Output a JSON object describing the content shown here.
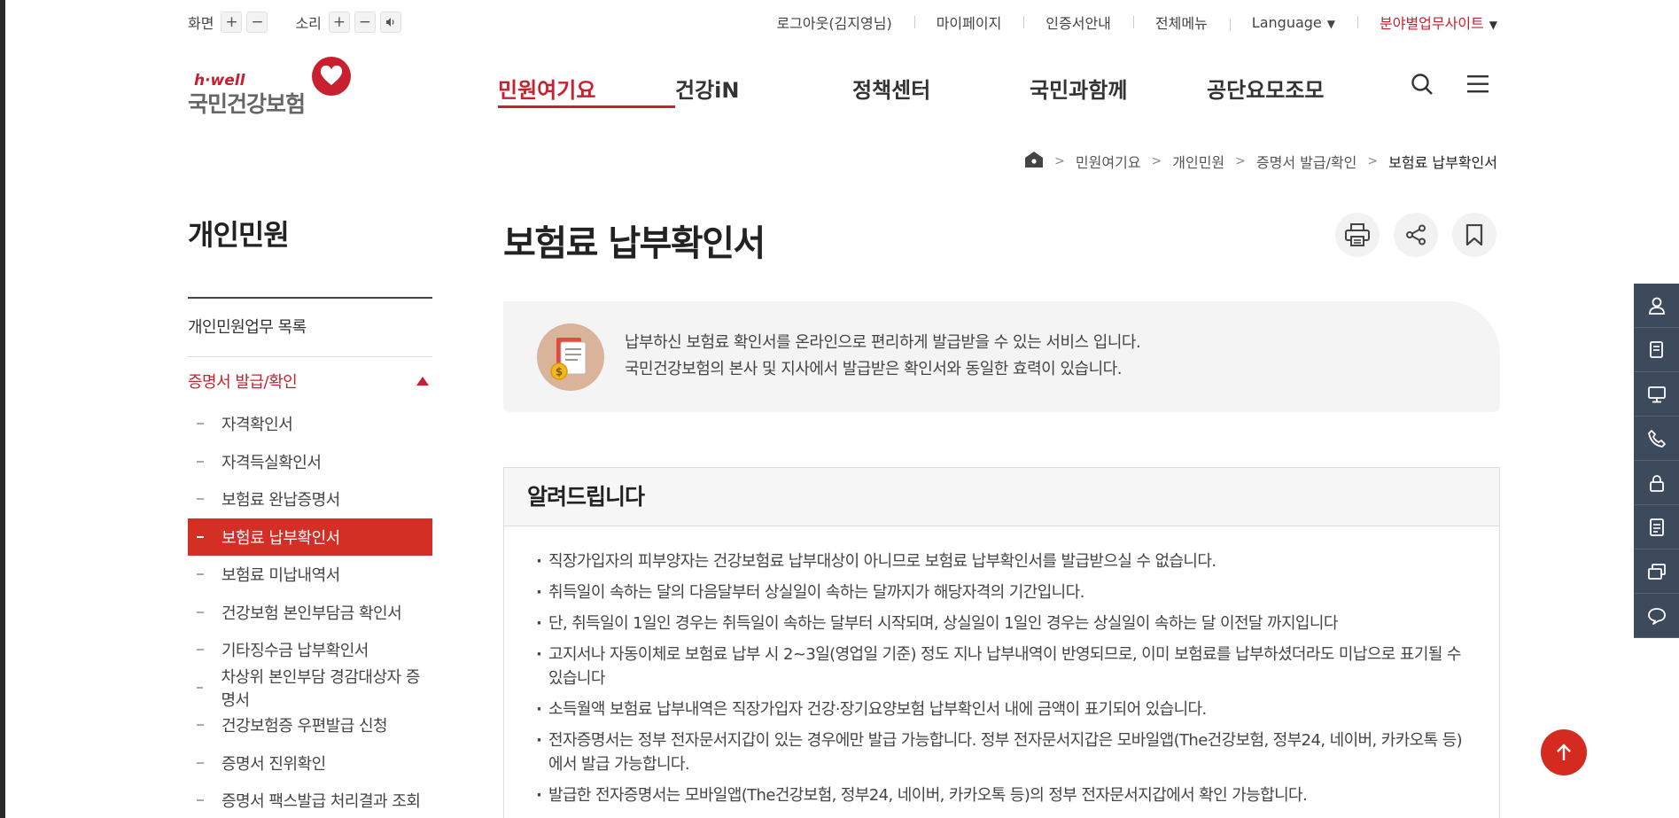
{
  "util": {
    "screen_label": "화면",
    "sound_label": "소리",
    "plus": "+",
    "minus": "−"
  },
  "top_links": [
    "로그아웃(김지영님)",
    "마이페이지",
    "인증서안내",
    "전체메뉴",
    "Language",
    "분야별업무사이트"
  ],
  "logo": {
    "brand_en": "h·well",
    "brand_ko": "국민건강보험"
  },
  "gnb": [
    "민원여기요",
    "건강iN",
    "정책센터",
    "국민과함께",
    "공단요모조모"
  ],
  "breadcrumb": [
    "민원여기요",
    "개인민원",
    "증명서 발급/확인",
    "보험료 납부확인서"
  ],
  "lnb": {
    "title": "개인민원",
    "top_item": "개인민원업무 목록",
    "open_section": "증명서 발급/확인",
    "items": [
      "자격확인서",
      "자격득실확인서",
      "보험료 완납증명서",
      "보험료 납부확인서",
      "보험료 미납내역서",
      "건강보험 본인부담금 확인서",
      "기타징수금 납부확인서",
      "차상위 본인부담 경감대상자 증명서",
      "건강보험증 우편발급 신청",
      "증명서 진위확인",
      "증명서 팩스발급 처리결과 조회"
    ],
    "active_index": 3
  },
  "page_title": "보험료 납부확인서",
  "intro": {
    "line1": "납부하신 보험료 확인서를 온라인으로 편리하게 발급받을 수 있는 서비스 입니다.",
    "line2": "국민건강보험의 본사 및 지사에서 발급받은 확인서와 동일한 효력이 있습니다."
  },
  "notice": {
    "title": "알려드립니다",
    "items": [
      "직장가입자의 피부양자는 건강보험료 납부대상이 아니므로 보험료 납부확인서를 발급받으실 수 없습니다.",
      "취득일이 속하는 달의 다음달부터 상실일이 속하는 달까지가 해당자격의 기간입니다.",
      "단, 취득일이 1일인 경우는 취득일이 속하는 달부터 시작되며, 상실일이 1일인 경우는 상실일이 속하는 달 이전달 까지입니다",
      "고지서나 자동이체로 보험료 납부 시 2~3일(영업일 기준) 정도 지나 납부내역이 반영되므로, 이미 보험료를 납부하셨더라도 미납으로 표기될 수 있습니다",
      "소득월액 보험료 납부내역은 직장가입자 건강·장기요양보험 납부확인서 내에 금액이 표기되어 있습니다.",
      "전자증명서는 정부 전자문서지갑이 있는 경우에만 발급 가능합니다. 정부 전자문서지갑은 모바일앱(The건강보험, 정부24, 네이버, 카카오톡 등)에서 발급 가능합니다.",
      "발급한 전자증명서는 모바일앱(The건강보험, 정부24, 네이버, 카카오톡 등)의 정부 전자문서지갑에서 확인 가능합니다."
    ]
  },
  "colors": {
    "brand_red": "#c8202f",
    "active_red": "#d32f24",
    "quick_bar": "#3d4a5c"
  },
  "icons": [
    "search-icon",
    "menu-icon",
    "home-icon",
    "print-icon",
    "share-icon",
    "bookmark-icon",
    "arrow-up-icon"
  ]
}
